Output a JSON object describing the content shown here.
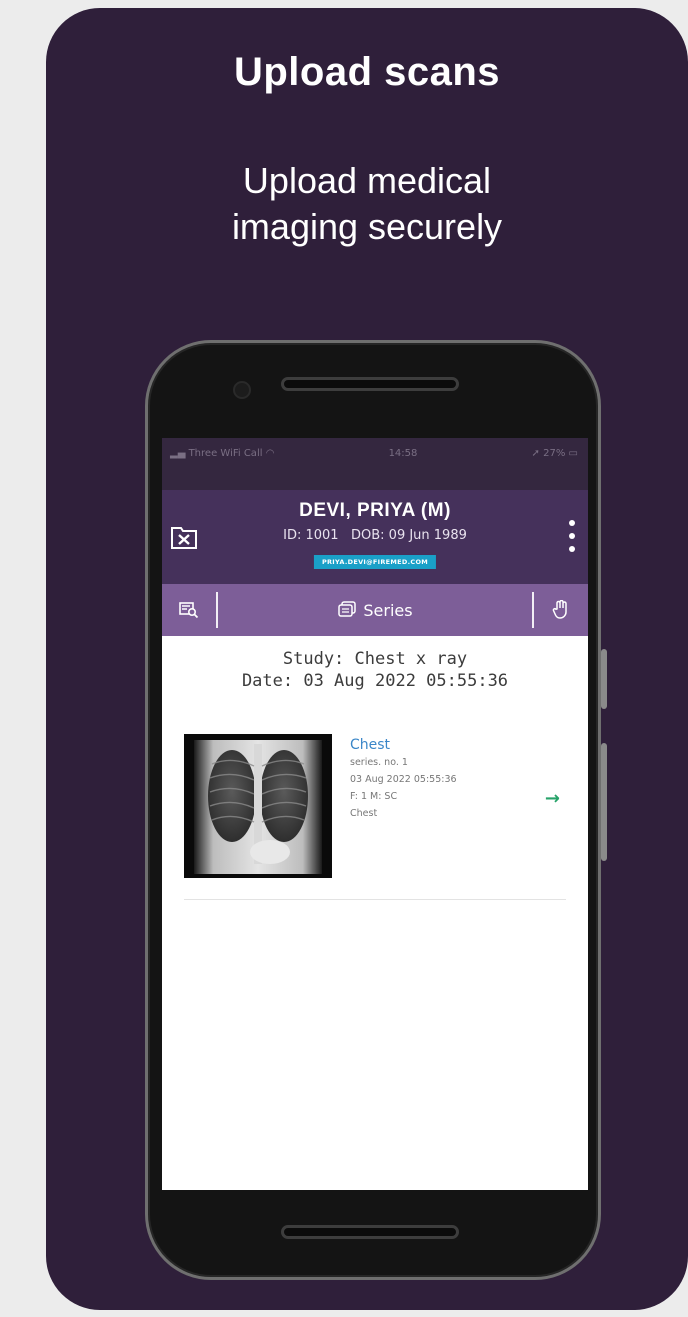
{
  "promo": {
    "title": "Upload scans",
    "subtitle": "Upload medical imaging securely"
  },
  "status_bar": {
    "carrier": "Three WiFi Call",
    "time": "14:58",
    "battery": "27%"
  },
  "patient": {
    "name": "DEVI, PRIYA (M)",
    "id_label": "ID:",
    "id": "1001",
    "dob_label": "DOB:",
    "dob": "09 Jun 1989",
    "email": "PRIYA.DEVI@FIREMED.COM"
  },
  "tabs": {
    "center_label": "Series"
  },
  "study": {
    "study_line": "Study: Chest x ray",
    "date_line": "Date: 03 Aug 2022 05:55:36"
  },
  "series": [
    {
      "title": "Chest",
      "series_no": "series. no. 1",
      "datetime": "03 Aug 2022 05:55:36",
      "fm": "F: 1 M: SC",
      "body_part": "Chest"
    }
  ],
  "colors": {
    "background_card": "#2f1f3a",
    "header": "#45315b",
    "tabbar": "#7d5e98",
    "email_badge": "#1aa0c8",
    "link_blue": "#3a86c8",
    "arrow_green": "#27a36a"
  },
  "icons": {
    "close_study": "folder-close-icon",
    "menu": "kebab-menu-icon",
    "search_study": "search-list-icon",
    "series": "series-stack-icon",
    "hand": "hand-pointer-icon",
    "next": "arrow-right-icon"
  }
}
